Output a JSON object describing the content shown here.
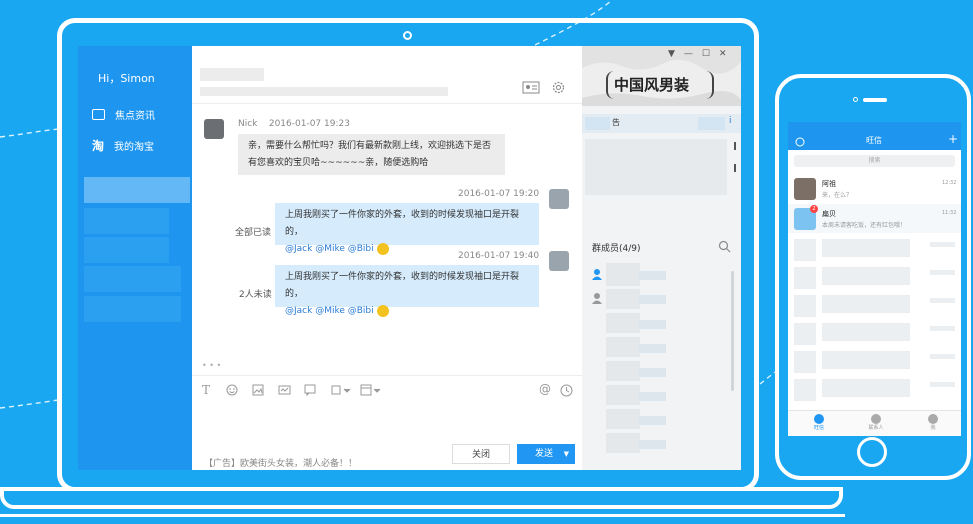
{
  "sidebar": {
    "greeting": "Hi，Simon",
    "items": [
      {
        "label": "焦点资讯",
        "icon": "news-icon"
      },
      {
        "label": "我的淘宝",
        "icon": "taobao-icon",
        "glyph": "淘"
      }
    ]
  },
  "window_controls": {
    "dropdown": "▼",
    "minimize": "—",
    "maximize": "☐",
    "close": "✕"
  },
  "messages": [
    {
      "sender": "Nick",
      "time": "2016-01-07  19:23",
      "text": "亲，需要什么帮忙吗？我们有最新款刚上线，欢迎挑选下是否有您喜欢的宝贝哈~~~~~~亲，随便选购哈"
    },
    {
      "time": "2016-01-07  19:20",
      "text": "上周我刚买了一件你家的外套，收到的时候发现袖口是开裂的，",
      "mentions": "@Jack @Mike @Bibi",
      "status": "全部已读"
    },
    {
      "time": "2016-01-07  19:40",
      "text": "上周我刚买了一件你家的外套，收到的时候发现袖口是开裂的，",
      "mentions": "@Jack @Mike @Bibi",
      "status": "2人未读"
    }
  ],
  "typing_indicator": "• • •",
  "toolbar": {
    "text_tool": "T",
    "at_tool": "@"
  },
  "ad_text": "【广告】欧美街头女装，潮人必备！！",
  "buttons": {
    "close": "关闭",
    "send": "发送",
    "send_dropdown": "▼"
  },
  "right_panel": {
    "banner_title": "中国风男装",
    "notice_fragment": "告",
    "notice_link": "i",
    "members_label": "群成员(4/9)"
  },
  "phone": {
    "title": "旺信",
    "add": "+",
    "search_placeholder": "搜索",
    "chats": [
      {
        "name": "阿祖",
        "preview": "来，在么？",
        "time": "12:32"
      },
      {
        "name": "扁贝",
        "preview": "本周末请客吃饭，还有红包哦！",
        "time": "11:32",
        "badge": "2"
      }
    ],
    "tabs": [
      "旺信",
      "联系人",
      "我"
    ]
  },
  "colors": {
    "accent": "#1e96f0",
    "background": "#18a7f0",
    "bubble_right": "#d6ecfd",
    "bubble_left": "#ececec",
    "mention": "#2a7bd6"
  }
}
